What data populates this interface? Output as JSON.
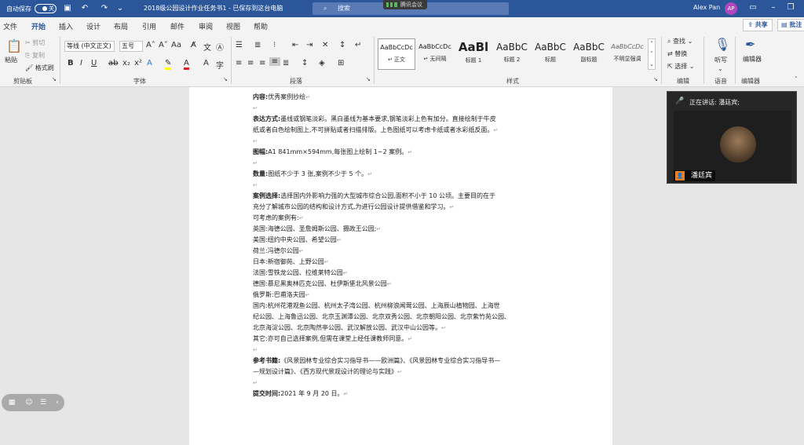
{
  "titlebar": {
    "autosave_label": "自动保存",
    "autosave_state": "关",
    "doc_title": "2018级公园设计作业任务书1 - 已保存到这台电脑",
    "search_placeholder": "搜索",
    "meeting_tag": "腾讯会议",
    "user_name": "Alex Pan",
    "avatar_initials": "AP"
  },
  "tabs": [
    "文件",
    "开始",
    "插入",
    "设计",
    "布局",
    "引用",
    "邮件",
    "审阅",
    "视图",
    "帮助"
  ],
  "share_label": "共享",
  "comment_label": "批注",
  "ribbon": {
    "clipboard": {
      "paste": "粘贴",
      "cut": "剪切",
      "copy": "复制",
      "format_painter": "格式刷",
      "label": "剪贴板"
    },
    "font": {
      "font_name": "等线 (中文正文)",
      "font_size": "五号",
      "label": "字体"
    },
    "paragraph": {
      "label": "段落"
    },
    "styles": {
      "label": "样式",
      "items": [
        {
          "sample": "AaBbCcDc",
          "name": "正文"
        },
        {
          "sample": "AaBbCcDc",
          "name": "无间隔"
        },
        {
          "sample": "AaBl",
          "name": "标题 1"
        },
        {
          "sample": "AaBbC",
          "name": "标题 2"
        },
        {
          "sample": "AaBbC",
          "name": "标题"
        },
        {
          "sample": "AaBbC",
          "name": "副标题"
        },
        {
          "sample": "AaBbCcDc",
          "name": "不明显强调"
        }
      ]
    },
    "editing": {
      "find": "查找",
      "replace": "替换",
      "select": "选择",
      "label": "编辑"
    },
    "voice": {
      "dictate": "听写",
      "label": "语音"
    },
    "editor": {
      "editor": "编辑器",
      "label": "编辑器"
    }
  },
  "document": {
    "l1_bold": "内容:",
    "l1_text": "优秀案例抄绘",
    "l2_bold": "表达方式:",
    "l2_text": "墨线或钢笔淡彩。黑白墨线为基本要求,钢笔淡彩上色有加分。直接绘制于牛皮",
    "l3_text": "纸或者白色绘制图上,不可拼贴或者扫描排版。上色图纸可以考虑卡纸或者水彩纸反面。",
    "l4_bold": "图幅:",
    "l4_text": "A1 841mm×594mm,每张图上绘制 1~2 案例。",
    "l5_bold": "数量:",
    "l5_text": "图纸不少于 3 张,案例不少于 5 个。",
    "l6_bold": "案例选择:",
    "l6_text": "选择国内外影响力强的大型城市综合公园,面积不小于 10 公顷。主要目的在于",
    "l7_text": "充分了解城市公园的结构和设计方式,为进行公园设计提供借鉴和学习。",
    "l8_text": "可考虑的案例有:",
    "l9_text": "英国:海德公园、圣詹姆斯公园、摄政王公园;",
    "l10_text": "美国:纽约中央公园、希望公园",
    "l11_text": "荷兰:冯德尔公园",
    "l12_text": "日本:新宿御苑、上野公园",
    "l13_text": "法国:雪铁龙公园、拉维莱特公园",
    "l14_text": "德国:慕尼黑奥林匹克公园、杜伊斯堡北风景公园",
    "l15_text": "俄罗斯:巴甫洛夫园",
    "l16_text": "国内:杭州花港观鱼公园、杭州太子湾公园、杭州柳浪闻莺公园、上海辰山植物园、上海世",
    "l17_text": "纪公园、上海鲁迅公园、北京玉渊潭公园、北京双秀公园、北京朝阳公园、北京紫竹苑公园、",
    "l18_text": "北京海淀公园、北京陶然亭公园、武汉解放公园、武汉中山公园等。",
    "l19_text": "其它:亦可自己选择案例,但需在课堂上经任课教师同意。",
    "l20_bold": "参考书籍:",
    "l20_text": "《风景园林专业综合实习指导书——欧洲篇》、《风景园林专业综合实习指导书—",
    "l21_text": "—规划设计篇》、《西方现代景观设计的理论与实践》",
    "l22_bold": "提交时间:",
    "l22_text": "2021 年 9 月 20 日。",
    "para_mark": "↵"
  },
  "video": {
    "speaking_label": "正在讲话: 潘廷宾;",
    "participant_name": "潘廷宾"
  },
  "colors": {
    "word_blue": "#2b579a",
    "avatar": "#b146c2",
    "user_badge": "#f0801e"
  }
}
